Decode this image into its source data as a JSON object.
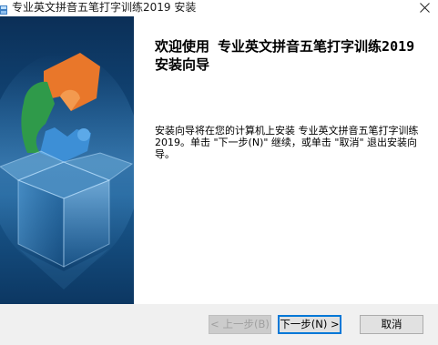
{
  "window": {
    "title": "专业英文拼音五笔打字训练2019 安装"
  },
  "welcome": {
    "heading": "欢迎使用 专业英文拼音五笔打字训练2019 安装向导",
    "description": "安装向导将在您的计算机上安装 专业英文拼音五笔打字训练2019。单击 \"下一步(N)\" 继续，或单击 \"取消\" 退出安装向导。"
  },
  "buttons": {
    "back_label": "< 上一步(B)",
    "next_label": "下一步(N) >",
    "cancel_label": "取消"
  },
  "colors": {
    "banner_dark": "#0b2f57",
    "banner_mid": "#1a5a90",
    "puzzle_orange": "#e9772a",
    "puzzle_green": "#2f9a4a",
    "puzzle_blue": "#3d8fd6",
    "default_button_border": "#0078d7",
    "footer_bg": "#f0f0f0"
  },
  "icons": {
    "app_icon": "installer-icon",
    "close": "close-icon",
    "banner_graphic": "puzzle-box-graphic"
  }
}
